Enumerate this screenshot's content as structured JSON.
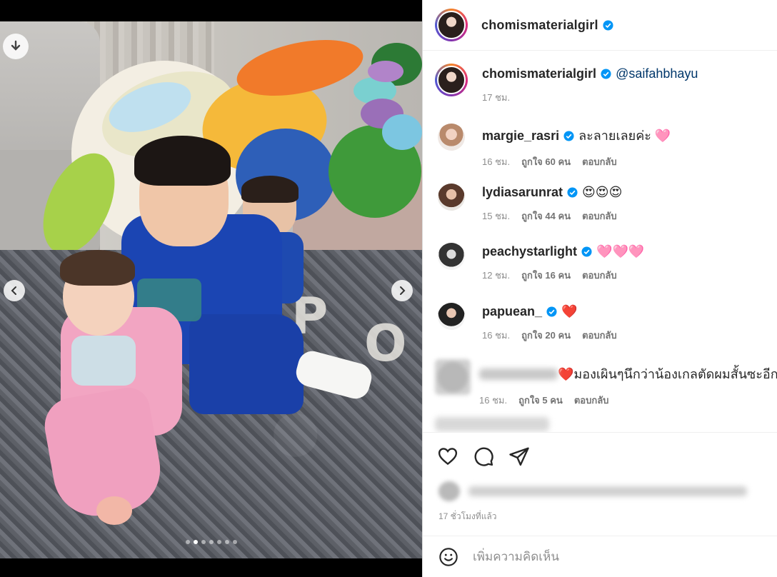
{
  "post": {
    "author": "chomismaterialgirl",
    "verified": true,
    "caption_mention": "@saifahbhayu",
    "caption_age": "17 ชม.",
    "time_ago": "17 ชั่วโมงที่แล้ว",
    "carousel": {
      "total": 7,
      "active": 2
    }
  },
  "comments": [
    {
      "user": "margie_rasri",
      "verified": true,
      "text": "ละลายเลยค่ะ 🩷",
      "age": "16 ชม.",
      "likes": "ถูกใจ 60 คน",
      "reply": "ตอบกลับ"
    },
    {
      "user": "lydiasarunrat",
      "verified": true,
      "text": "😍😍😍",
      "age": "15 ชม.",
      "likes": "ถูกใจ 44 คน",
      "reply": "ตอบกลับ"
    },
    {
      "user": "peachystarlight",
      "verified": true,
      "text": "🩷🩷🩷",
      "age": "12 ชม.",
      "likes": "ถูกใจ 16 คน",
      "reply": "ตอบกลับ"
    },
    {
      "user": "papuean_",
      "verified": true,
      "text": "❤️",
      "age": "16 ชม.",
      "likes": "ถูกใจ 20 คน",
      "reply": "ตอบกลับ"
    },
    {
      "user": "",
      "verified": false,
      "text": "❤️มองเผินๆนึกว่าน้องเกลตัดผมสั้นซะอีก ☺️",
      "age": "16 ชม.",
      "likes": "ถูกใจ 5 คน",
      "reply": "ตอบกลับ"
    }
  ],
  "add_comment_placeholder": "เพิ่มความคิดเห็น",
  "icons": [
    "download-icon",
    "chevron-left-icon",
    "chevron-right-icon",
    "heart-icon",
    "comment-icon",
    "share-icon",
    "emoji-icon",
    "verified-icon"
  ],
  "colors": {
    "verified": "#0095f6",
    "mention": "#00376b",
    "meta": "#8e8e8e"
  }
}
